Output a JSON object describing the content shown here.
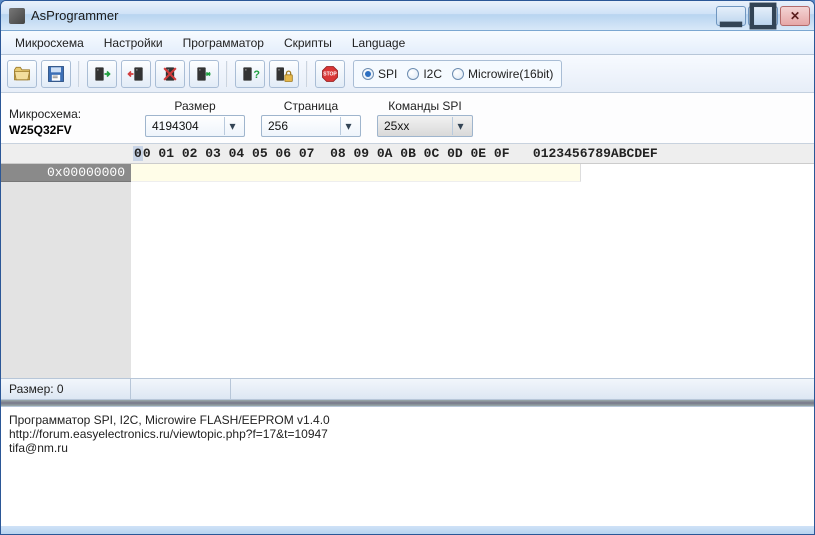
{
  "window": {
    "title": "AsProgrammer"
  },
  "menu": {
    "chip": "Микросхема",
    "settings": "Настройки",
    "programmer": "Программатор",
    "scripts": "Скрипты",
    "language": "Language"
  },
  "toolbar": {
    "protocols": {
      "spi": "SPI",
      "i2c": "I2C",
      "microwire": "Microwire(16bit)",
      "selected": "spi"
    }
  },
  "params": {
    "chip_label": "Микросхема:",
    "chip_value": "W25Q32FV",
    "size_label": "Размер",
    "size_value": "4194304",
    "page_label": "Страница",
    "page_value": "256",
    "cmd_label": "Команды SPI",
    "cmd_value": "25xx"
  },
  "hex": {
    "header_a": "00 01 02 03 04 05 06 07",
    "header_b": "08 09 0A 0B 0C 0D 0E 0F",
    "header_ascii": "0123456789ABCDEF",
    "addr0": "0x00000000"
  },
  "status": {
    "size_label": "Размер: 0"
  },
  "log": {
    "line1": "Программатор SPI, I2C, Microwire FLASH/EEPROM v1.4.0",
    "line2": "http://forum.easyelectronics.ru/viewtopic.php?f=17&t=10947",
    "line3": "tifa@nm.ru"
  }
}
